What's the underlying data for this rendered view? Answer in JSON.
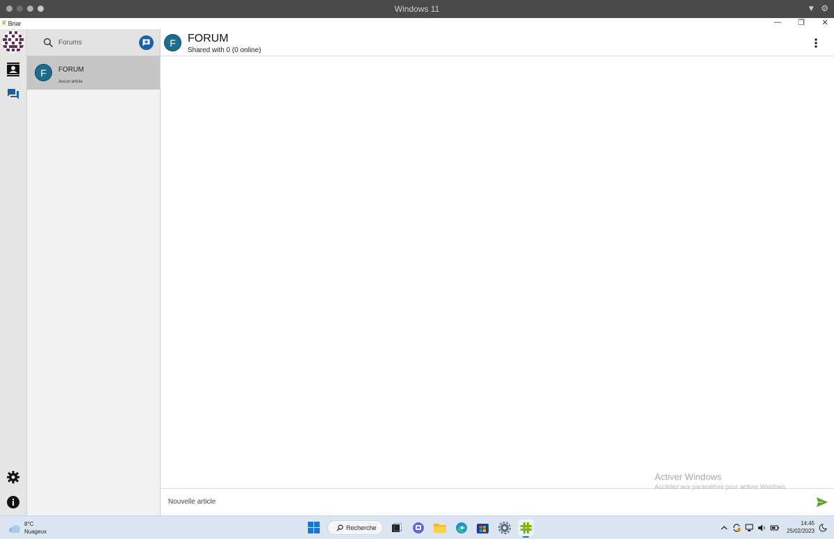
{
  "host": {
    "vm_title": "Windows 11"
  },
  "app": {
    "name": "Briar",
    "window_controls": {
      "minimize": "—",
      "restore": "❐",
      "close": "✕"
    }
  },
  "sidebar": {
    "search_placeholder": "Forums",
    "forums": [
      {
        "initial": "F",
        "name": "FORUM",
        "subtitle": "Aucun article"
      }
    ]
  },
  "conversation": {
    "initial": "F",
    "title": "FORUM",
    "subtitle": "Shared with 0 (0 online)",
    "composer_placeholder": "Nouvelle article"
  },
  "watermark": {
    "title": "Activer Windows",
    "subtitle": "Accédez aux paramètres pour activer Windows."
  },
  "taskbar": {
    "weather_temp": "8°C",
    "weather_desc": "Nuageux",
    "search_label": "Recherche",
    "time": "14:45",
    "date": "25/02/2023"
  },
  "colors": {
    "accent_blue": "#1a5fa3",
    "forum_avatar": "#1c6e8c",
    "briar_green": "#7ab800",
    "selected_row": "#c6c6c6"
  }
}
